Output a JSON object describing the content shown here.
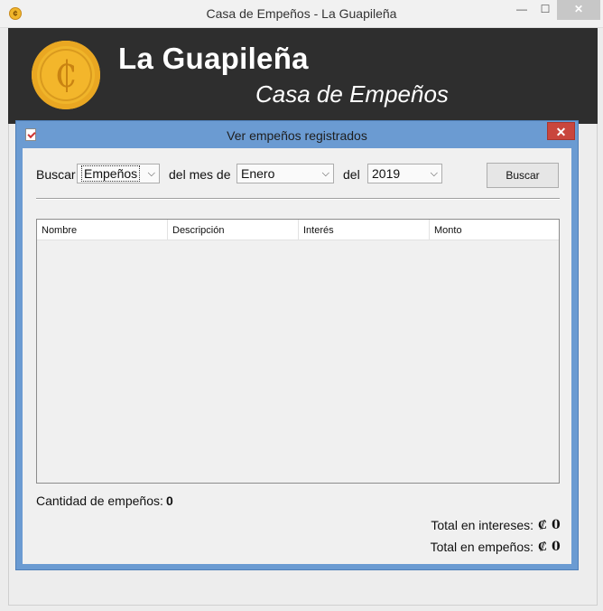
{
  "window": {
    "title": "Casa de Empeños - La Guapileña",
    "min_glyph": "—",
    "max_glyph": "☐",
    "close_glyph": "✕"
  },
  "banner": {
    "coin_symbol": "₵",
    "name": "La Guapileña",
    "subtitle": "Casa de Empeños"
  },
  "dialog": {
    "title": "Ver empeños registrados",
    "close_glyph": "✕"
  },
  "filters": {
    "buscar_label": "Buscar",
    "type_selected": "Empeños",
    "month_label": "del mes de",
    "month_selected": "Enero",
    "year_label": "del",
    "year_selected": "2019",
    "search_button": "Buscar"
  },
  "table": {
    "columns": [
      "Nombre",
      "Descripción",
      "Interés",
      "Monto"
    ],
    "rows": []
  },
  "summary": {
    "count_label": "Cantidad de empeños:",
    "count_value": "0",
    "interest_label": "Total en intereses:",
    "interest_value": "₡ 0",
    "pawns_label": "Total en empeños:",
    "pawns_value": "₡ 0"
  },
  "colors": {
    "banner_bg": "#2e2e2e",
    "dialog_frame": "#6b9bd2",
    "close_button": "#c9463d",
    "coin": "#f0b52a"
  }
}
